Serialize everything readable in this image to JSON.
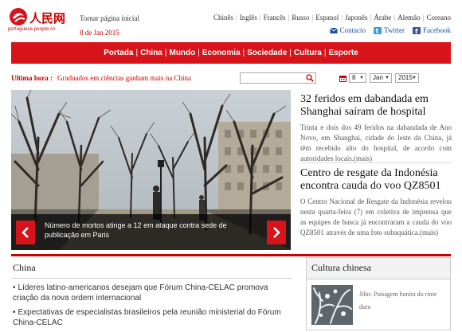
{
  "header": {
    "logo_text": "人民网",
    "logo_subtext": "portuguese.people.cn",
    "home_link": "Tornar página inicial",
    "date": "8 de Jan 2015",
    "languages": [
      "Chinês",
      "Inglês",
      "Francês",
      "Russo",
      "Espanol",
      "Japonês",
      "Árabe",
      "Alemão",
      "Coreano"
    ],
    "socials": [
      {
        "label": "Contacto",
        "icon": "mail-icon"
      },
      {
        "label": "Twitter",
        "icon": "twitter-icon"
      },
      {
        "label": "Facebook",
        "icon": "facebook-icon"
      }
    ]
  },
  "nav": {
    "items": [
      "Portada",
      "China",
      "Mundo",
      "Economia",
      "Sociedade",
      "Cultura",
      "Esporte"
    ]
  },
  "breaking": {
    "label": "Ultima hora :",
    "text": "Graduados em ciências ganham mais na China"
  },
  "search": {
    "placeholder": ""
  },
  "date_picker": {
    "day": "8",
    "month": "Jan",
    "year": "2015"
  },
  "hero": {
    "caption": "Número de mortos atinge a 12 em ataque contra sede de publicação em Paris"
  },
  "stories": [
    {
      "title": "32 feridos em dabandada em Shanghai saíram de hospital",
      "body": "Trinta e dois dos 49 feridos na dabandada de Ano Novo, em Shanghai, cidade do leste da China, já têm recebido alto do hospital, de acordo com autoridades locais.(mais)"
    },
    {
      "title": "Centro de resgate da Indonésia encontra cauda do voo QZ8501",
      "body": "O Centro Nacional de Resgate da Indonésia revelou nesta quarta-feira (7) em coletiva de imprensa que as equipes de busca já encontraram a cauda do voo QZ8501 através de uma foto subaquática.(mais)"
    }
  ],
  "china": {
    "title": "China",
    "items": [
      "Líderes latino-americanos desejam que Fórum China-CELAC promova criação da nova ordem internacional",
      "Expectativas de especialistas brasileiros pela reunião ministerial do Fórum China-CELAC"
    ]
  },
  "culture": {
    "title": "Cultura chinesa",
    "item_caption": "Jilin: Paisagem bonita do rime duro"
  },
  "colors": {
    "brand_red": "#d7141a",
    "link_blue": "#1a4fa0"
  }
}
